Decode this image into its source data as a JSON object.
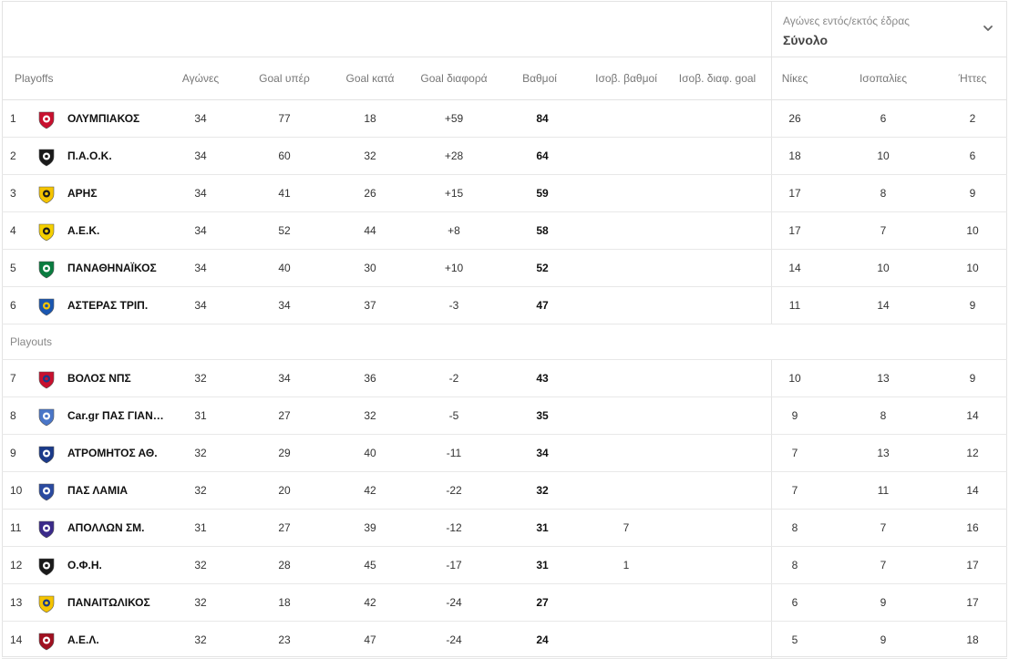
{
  "venue_filter": {
    "caption": "Αγώνες εντός/εκτός έδρας",
    "selected": "Σύνολο"
  },
  "columns": {
    "section": "Playoffs",
    "played": "Αγώνες",
    "goals_for": "Goal υπέρ",
    "goals_against": "Goal κατά",
    "goal_diff": "Goal διαφορά",
    "points": "Βαθμοί",
    "tie_points": "Ισοβ. βαθμοί",
    "tie_goal_diff": "Ισοβ. διαφ. goal",
    "wins": "Νίκες",
    "draws": "Ισοπαλίες",
    "losses": "Ήττες"
  },
  "playouts_label": "Playouts",
  "teams": [
    {
      "pos": "1",
      "name": "ΟΛΥΜΠΙΑΚΟΣ",
      "played": "34",
      "gf": "77",
      "ga": "18",
      "gd": "+59",
      "pts": "84",
      "tie_pts": "",
      "tie_gd": "",
      "w": "26",
      "d": "6",
      "l": "2",
      "logo": "olympiakos-crest",
      "colors": [
        "#c8102e",
        "#ffffff"
      ]
    },
    {
      "pos": "2",
      "name": "Π.Α.Ο.Κ.",
      "played": "34",
      "gf": "60",
      "ga": "32",
      "gd": "+28",
      "pts": "64",
      "tie_pts": "",
      "tie_gd": "",
      "w": "18",
      "d": "10",
      "l": "6",
      "logo": "paok-crest",
      "colors": [
        "#1a1a1a",
        "#ffffff"
      ]
    },
    {
      "pos": "3",
      "name": "ΑΡΗΣ",
      "played": "34",
      "gf": "41",
      "ga": "26",
      "gd": "+15",
      "pts": "59",
      "tie_pts": "",
      "tie_gd": "",
      "w": "17",
      "d": "8",
      "l": "9",
      "logo": "aris-crest",
      "colors": [
        "#f5c400",
        "#1a1a1a"
      ]
    },
    {
      "pos": "4",
      "name": "Α.Ε.Κ.",
      "played": "34",
      "gf": "52",
      "ga": "44",
      "gd": "+8",
      "pts": "58",
      "tie_pts": "",
      "tie_gd": "",
      "w": "17",
      "d": "7",
      "l": "10",
      "logo": "aek-crest",
      "colors": [
        "#f5d000",
        "#1a1a1a"
      ]
    },
    {
      "pos": "5",
      "name": "ΠΑΝΑΘΗΝΑΪΚΟΣ",
      "played": "34",
      "gf": "40",
      "ga": "30",
      "gd": "+10",
      "pts": "52",
      "tie_pts": "",
      "tie_gd": "",
      "w": "14",
      "d": "10",
      "l": "10",
      "logo": "panathinaikos-crest",
      "colors": [
        "#0a7c3f",
        "#ffffff"
      ]
    },
    {
      "pos": "6",
      "name": "ΑΣΤΕΡΑΣ ΤΡΙΠ.",
      "played": "34",
      "gf": "34",
      "ga": "37",
      "gd": "-3",
      "pts": "47",
      "tie_pts": "",
      "tie_gd": "",
      "w": "11",
      "d": "14",
      "l": "9",
      "logo": "asteras-crest",
      "colors": [
        "#1a56b0",
        "#f5c400"
      ]
    },
    {
      "pos": "7",
      "name": "ΒΟΛΟΣ ΝΠΣ",
      "played": "32",
      "gf": "34",
      "ga": "36",
      "gd": "-2",
      "pts": "43",
      "tie_pts": "",
      "tie_gd": "",
      "w": "10",
      "d": "13",
      "l": "9",
      "logo": "volos-crest",
      "colors": [
        "#c8102e",
        "#1a3a8a"
      ]
    },
    {
      "pos": "8",
      "name": "Car.gr ΠΑΣ ΓΙΑΝΝΕΝΑ",
      "played": "31",
      "gf": "27",
      "ga": "32",
      "gd": "-5",
      "pts": "35",
      "tie_pts": "",
      "tie_gd": "",
      "w": "9",
      "d": "8",
      "l": "14",
      "logo": "pas-giannina-crest",
      "colors": [
        "#4a76c8",
        "#ffffff"
      ]
    },
    {
      "pos": "9",
      "name": "ΑΤΡΟΜΗΤΟΣ ΑΘ.",
      "played": "32",
      "gf": "29",
      "ga": "40",
      "gd": "-11",
      "pts": "34",
      "tie_pts": "",
      "tie_gd": "",
      "w": "7",
      "d": "13",
      "l": "12",
      "logo": "atromitos-crest",
      "colors": [
        "#1a3a8a",
        "#ffffff"
      ]
    },
    {
      "pos": "10",
      "name": "ΠΑΣ ΛΑΜΙΑ",
      "played": "32",
      "gf": "20",
      "ga": "42",
      "gd": "-22",
      "pts": "32",
      "tie_pts": "",
      "tie_gd": "",
      "w": "7",
      "d": "11",
      "l": "14",
      "logo": "lamia-crest",
      "colors": [
        "#2a4aa0",
        "#ffffff"
      ]
    },
    {
      "pos": "11",
      "name": "ΑΠΟΛΛΩΝ ΣΜ.",
      "played": "31",
      "gf": "27",
      "ga": "39",
      "gd": "-12",
      "pts": "31",
      "tie_pts": "7",
      "tie_gd": "",
      "w": "8",
      "d": "7",
      "l": "16",
      "logo": "apollon-crest",
      "colors": [
        "#3a2a8a",
        "#ffffff"
      ]
    },
    {
      "pos": "12",
      "name": "Ο.Φ.Η.",
      "played": "32",
      "gf": "28",
      "ga": "45",
      "gd": "-17",
      "pts": "31",
      "tie_pts": "1",
      "tie_gd": "",
      "w": "8",
      "d": "7",
      "l": "17",
      "logo": "ofi-crest",
      "colors": [
        "#1a1a1a",
        "#ffffff"
      ]
    },
    {
      "pos": "13",
      "name": "ΠΑΝΑΙΤΩΛΙΚΟΣ",
      "played": "32",
      "gf": "18",
      "ga": "42",
      "gd": "-24",
      "pts": "27",
      "tie_pts": "",
      "tie_gd": "",
      "w": "6",
      "d": "9",
      "l": "17",
      "logo": "panaitolikos-crest",
      "colors": [
        "#f5c400",
        "#1a3a8a"
      ]
    },
    {
      "pos": "14",
      "name": "Α.Ε.Λ.",
      "played": "32",
      "gf": "23",
      "ga": "47",
      "gd": "-24",
      "pts": "24",
      "tie_pts": "",
      "tie_gd": "",
      "w": "5",
      "d": "9",
      "l": "18",
      "logo": "ael-crest",
      "colors": [
        "#a01020",
        "#ffffff"
      ]
    }
  ]
}
